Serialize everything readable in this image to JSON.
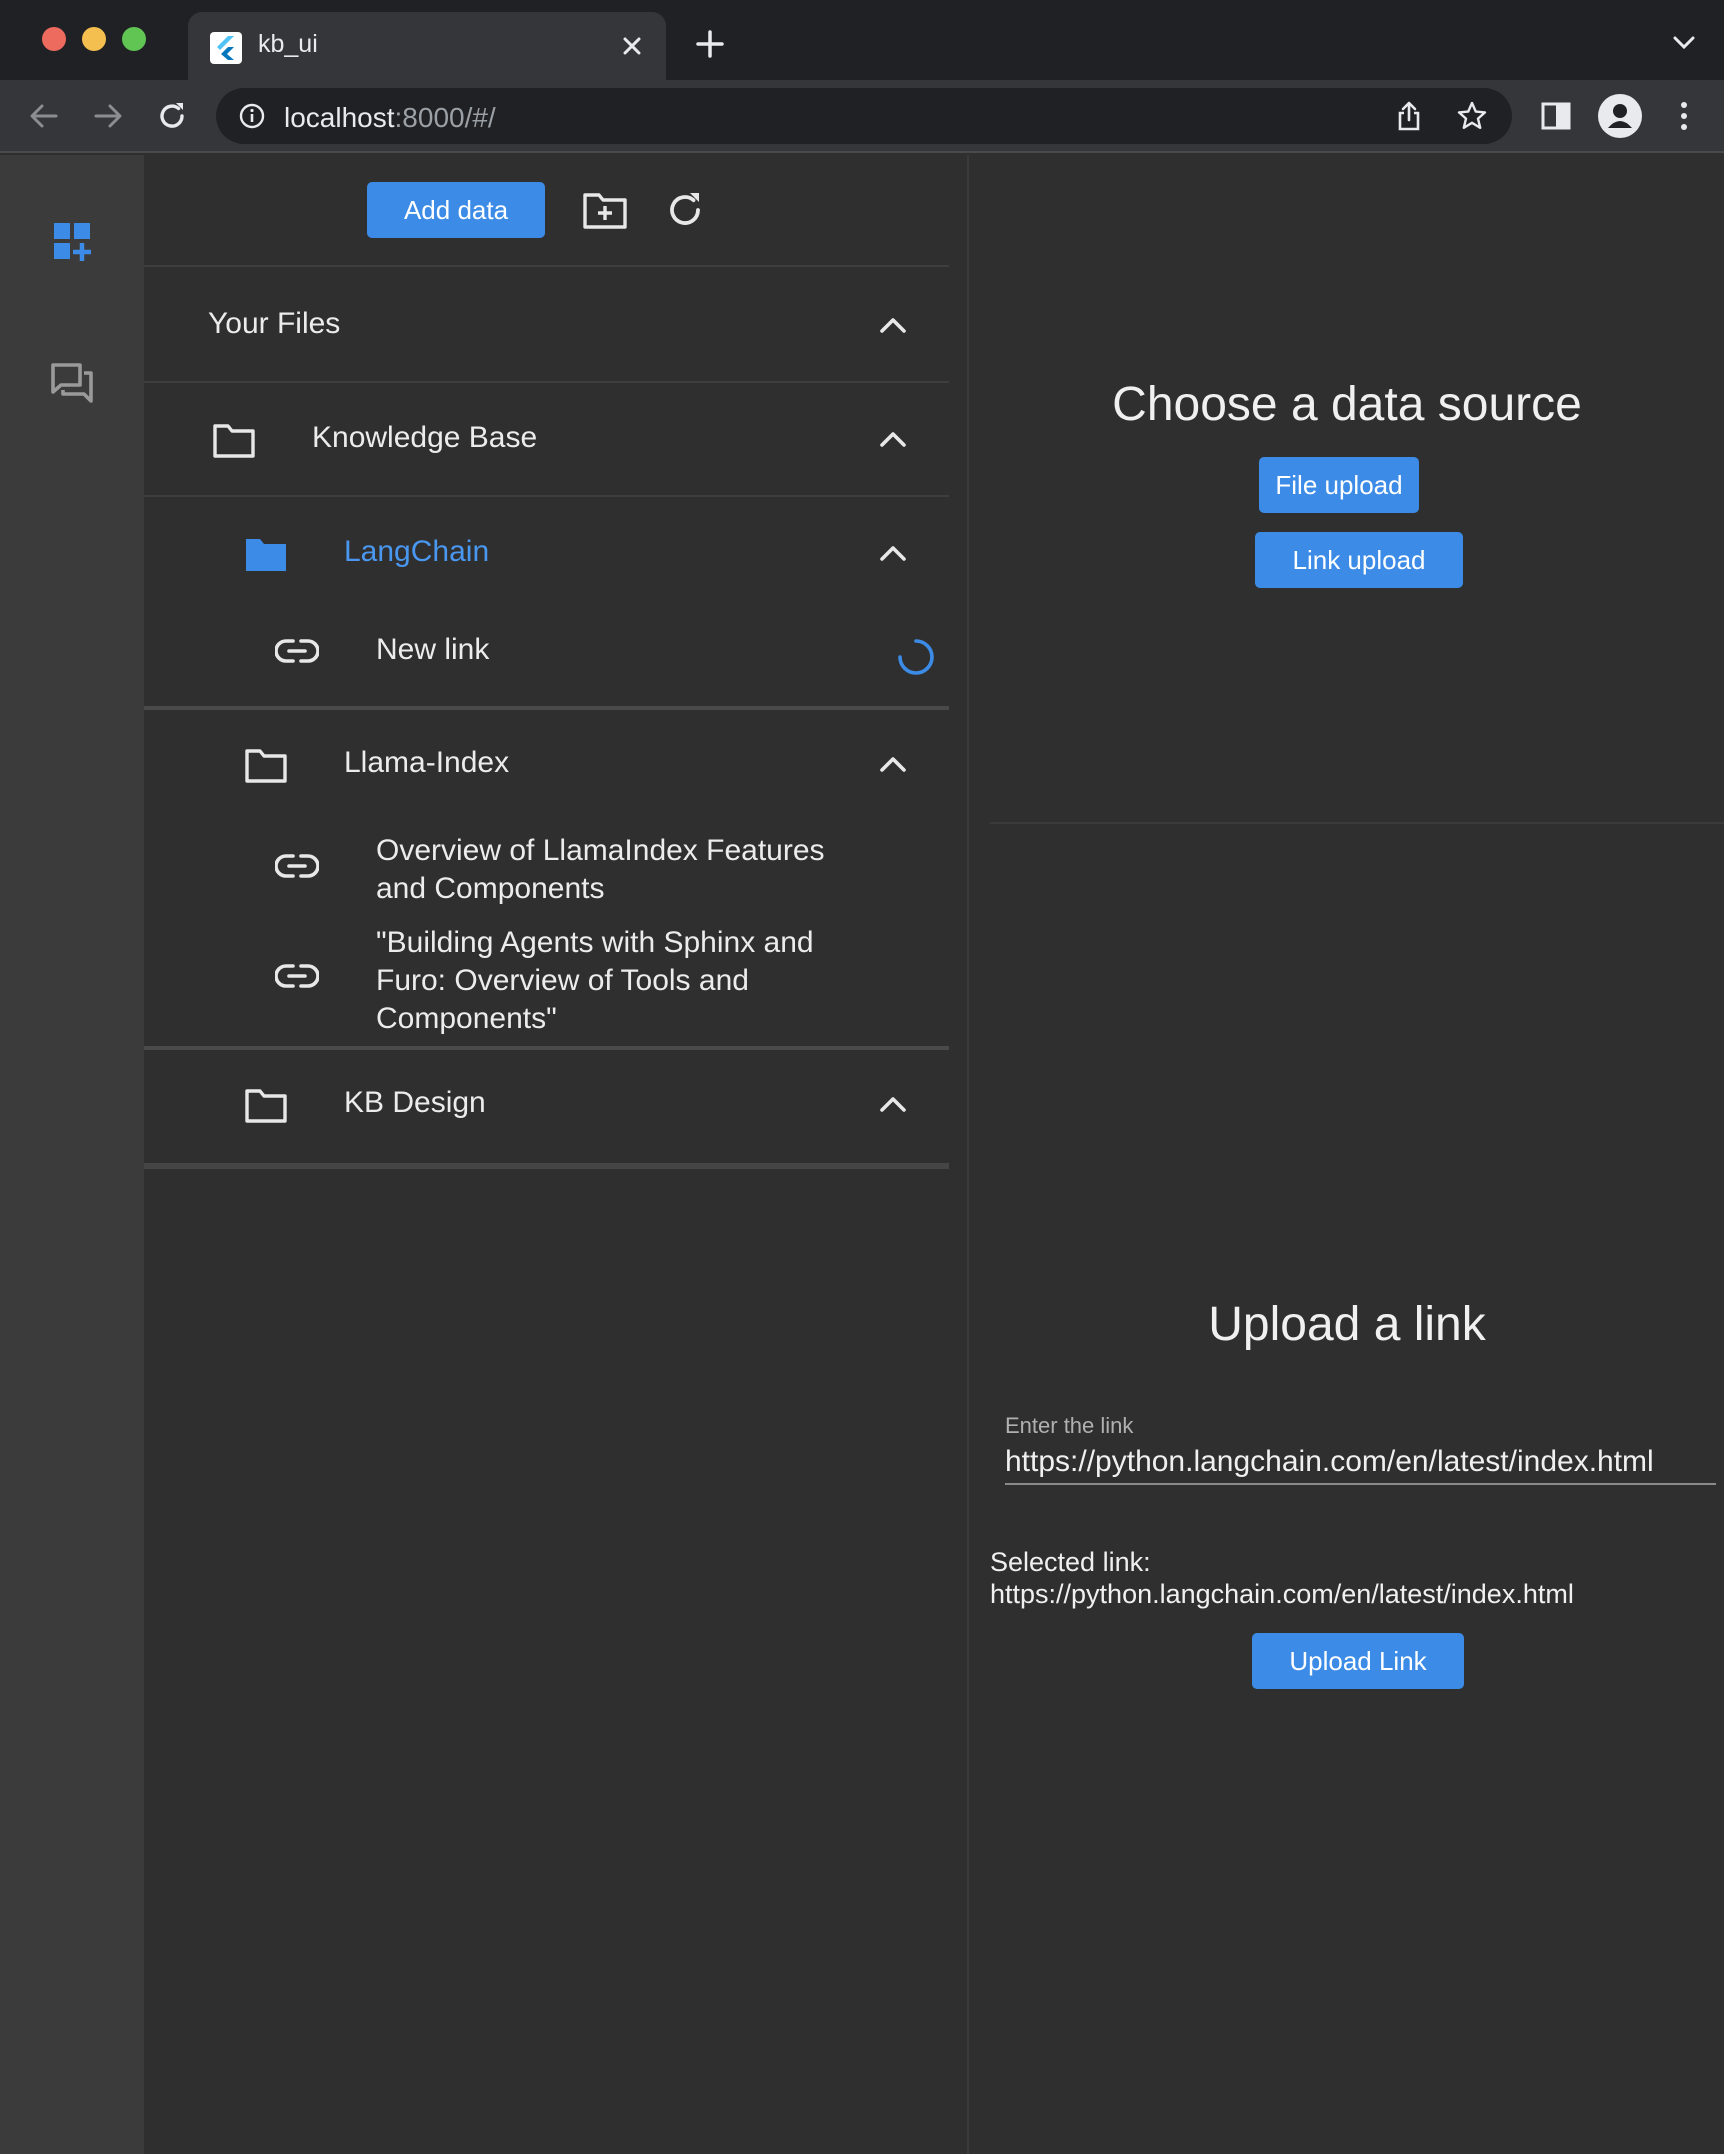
{
  "browser": {
    "tab_title": "kb_ui",
    "url_host": "localhost",
    "url_rest": ":8000/#/"
  },
  "files_panel": {
    "add_data_label": "Add data",
    "your_files_label": "Your Files",
    "knowledge_base_label": "Knowledge Base",
    "folders": [
      {
        "name": "LangChain",
        "selected": true,
        "items": [
          "New link"
        ]
      },
      {
        "name": "Llama-Index",
        "selected": false,
        "items": [
          "Overview of LlamaIndex Features and Components",
          "\"Building Agents with Sphinx and Furo: Overview of Tools and Components\""
        ]
      },
      {
        "name": "KB Design",
        "selected": false,
        "items": []
      }
    ]
  },
  "data_source": {
    "heading": "Choose a data source",
    "file_upload_label": "File upload",
    "link_upload_label": "Link upload"
  },
  "upload_link": {
    "heading": "Upload a link",
    "field_label": "Enter the link",
    "field_value": "https://python.langchain.com/en/latest/index.html",
    "selected_link_text": "Selected link: https://python.langchain.com/en/latest/index.html",
    "upload_button_label": "Upload Link"
  },
  "colors": {
    "accent": "#3c8ce7",
    "selected_text": "#4a97ef",
    "background": "#2f2f2f",
    "rail": "#3b3b3b"
  },
  "icons": {
    "rail": [
      "dashboard-add-icon",
      "chat-icon"
    ],
    "toolbar": [
      "new-folder-icon",
      "refresh-icon"
    ]
  }
}
